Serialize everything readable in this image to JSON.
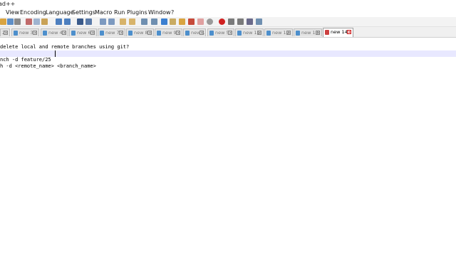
{
  "window": {
    "title": "ad++"
  },
  "menu": [
    "View",
    "Encoding",
    "Language",
    "Settings",
    "Macro",
    "Run",
    "Plugins",
    "Window",
    "?"
  ],
  "toolbar": {
    "buttons": [
      "new-file-icon",
      "open-file-icon",
      "save-icon",
      "print-icon",
      "cut-icon",
      "copy-icon",
      "paste-icon",
      "undo-icon",
      "redo-icon",
      "find-icon",
      "replace-icon",
      "zoom-in-icon",
      "zoom-out-icon",
      "sync-vertical-icon",
      "sync-horizontal-icon",
      "word-wrap-icon",
      "indent-guide-icon",
      "all-chars-icon",
      "doc-map-icon",
      "function-list-icon",
      "folder-icon",
      "monitor-icon",
      "record-macro-icon",
      "stop-macro-icon",
      "play-macro-icon",
      "run-macro-icon",
      "save-macro-icon"
    ]
  },
  "tabs": [
    {
      "label": "2",
      "active": false
    },
    {
      "label": "new 3",
      "active": false
    },
    {
      "label": "new 4",
      "active": false
    },
    {
      "label": "new 6",
      "active": false
    },
    {
      "label": "new 7",
      "active": false
    },
    {
      "label": "new 8",
      "active": false
    },
    {
      "label": "new 9",
      "active": false
    },
    {
      "label": "new 10",
      "active": false
    },
    {
      "label": "new 5",
      "active": false
    },
    {
      "label": "new 11",
      "active": false
    },
    {
      "label": "new 12",
      "active": false
    },
    {
      "label": "new 13",
      "active": false
    },
    {
      "label": "new 14",
      "active": true
    }
  ],
  "editor": {
    "lines": [
      "delete local and remote branches using git?",
      "",
      "nch -d feature/25",
      "h -d <remote_name> <branch_name>"
    ],
    "current_line": 3
  }
}
